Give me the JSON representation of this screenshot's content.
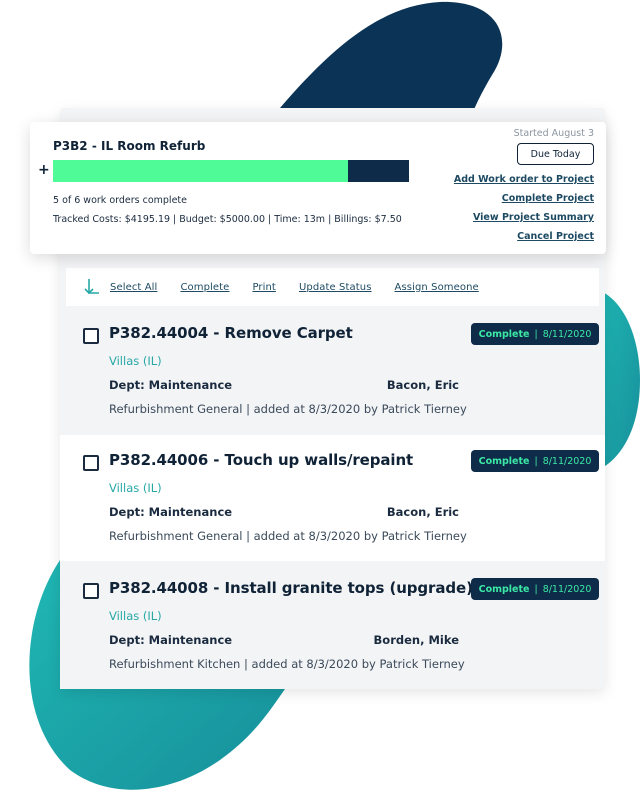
{
  "project": {
    "title": "P3B2 - IL Room Refurb",
    "plus": "+",
    "progress_fraction": 0.83,
    "count_text": "5 of 6 work orders complete",
    "costs_text": "Tracked Costs: $4195.19 | Budget: $5000.00 | Time: 13m | Billings: $7.50",
    "started": "Started August 3",
    "due_label": "Due Today",
    "links": [
      "Add Work order to Project",
      "Complete Project",
      "View Project Summary",
      "Cancel Project"
    ]
  },
  "toolbar": {
    "select_all": "Select All",
    "complete": "Complete",
    "print": "Print",
    "update_status": "Update Status",
    "assign": "Assign Someone"
  },
  "work_orders": [
    {
      "title": "P382.44004 - Remove Carpet",
      "location": "Villas (IL)",
      "dept": "Dept: Maintenance",
      "assignee": "Bacon, Eric",
      "meta": "Refurbishment General | added at 8/3/2020 by Patrick Tierney",
      "status": "Complete",
      "date": "8/11/2020"
    },
    {
      "title": "P382.44006 - Touch up walls/repaint",
      "location": "Villas (IL)",
      "dept": "Dept: Maintenance",
      "assignee": "Bacon, Eric",
      "meta": "Refurbishment General | added at 8/3/2020 by Patrick Tierney",
      "status": "Complete",
      "date": "8/11/2020"
    },
    {
      "title": "P382.44008 - Install granite tops (upgrade)",
      "location": "Villas (IL)",
      "dept": "Dept: Maintenance",
      "assignee": "Borden, Mike",
      "meta": "Refurbishment Kitchen | added at 8/3/2020 by Patrick Tierney",
      "status": "Complete",
      "date": "8/11/2020"
    }
  ],
  "colors": {
    "navy": "#0e2c4a",
    "teal": "#1aa6a6",
    "green": "#4efb96",
    "link": "#1d4a62"
  }
}
